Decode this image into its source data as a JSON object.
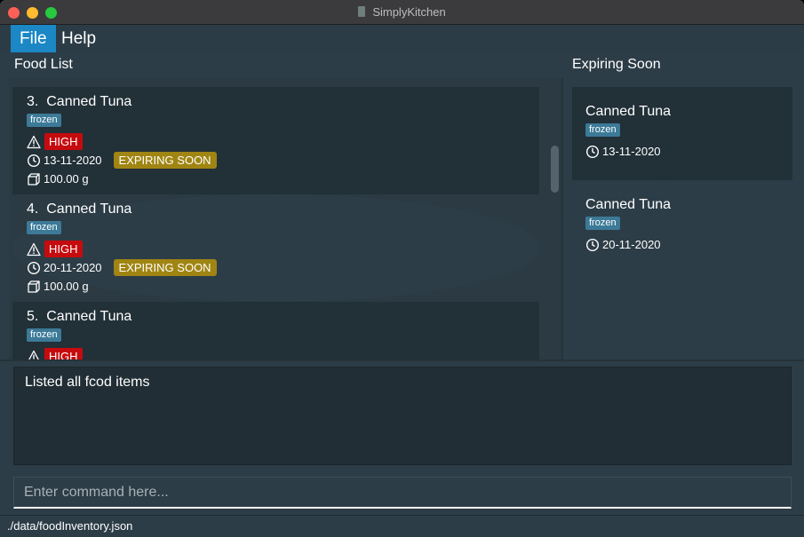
{
  "window": {
    "title": "SimplyKitchen",
    "traffic_lights": [
      "#fe5f57",
      "#febc2e",
      "#28c840"
    ]
  },
  "menu": {
    "items": [
      {
        "label": "File",
        "active": true
      },
      {
        "label": "Help",
        "active": false
      }
    ]
  },
  "food_list": {
    "header": "Food List",
    "items": [
      {
        "index": "3.",
        "name": "Canned Tuna",
        "tag": "frozen",
        "priority": "HIGH",
        "expiry": "13-11-2020",
        "badge": "EXPIRING SOON",
        "amount": "100.00 g"
      },
      {
        "index": "4.",
        "name": "Canned Tuna",
        "tag": "frozen",
        "priority": "HIGH",
        "expiry": "20-11-2020",
        "badge": "EXPIRING SOON",
        "amount": "100.00 g"
      },
      {
        "index": "5.",
        "name": "Canned Tuna",
        "tag": "frozen",
        "priority": "HIGH"
      }
    ]
  },
  "expiring_soon": {
    "header": "Expiring Soon",
    "items": [
      {
        "name": "Canned Tuna",
        "tag": "frozen",
        "expiry": "13-11-2020"
      },
      {
        "name": "Canned Tuna",
        "tag": "frozen",
        "expiry": "20-11-2020"
      }
    ]
  },
  "result": {
    "text": "Listed all fcod items"
  },
  "command": {
    "placeholder": "Enter command here..."
  },
  "status": {
    "path": "./data/foodInventory.json"
  },
  "colors": {
    "accent": "#1b87c4",
    "tag": "#3c7a98",
    "high": "#c60b0f",
    "expiring": "#a08512",
    "background": "#2d3d47"
  },
  "icons": {
    "priority": "warning-triangle-icon",
    "expiry": "clock-icon",
    "amount": "box-icon"
  }
}
